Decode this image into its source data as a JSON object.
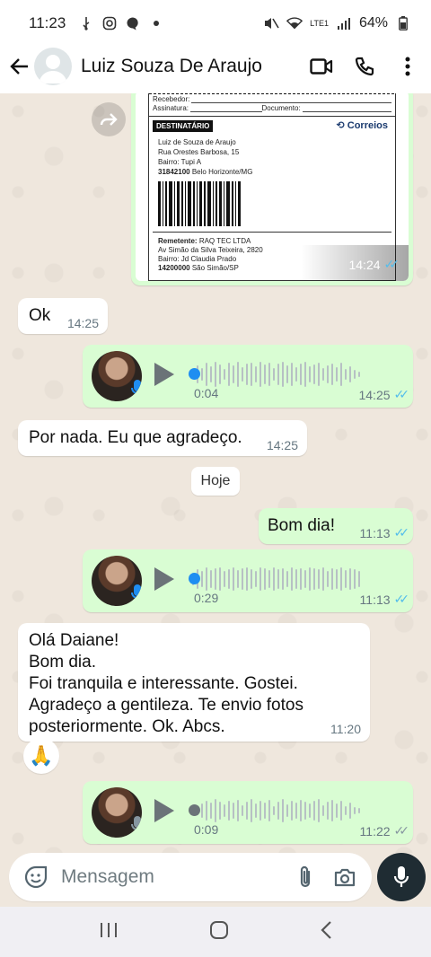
{
  "status": {
    "time": "11:23",
    "battery": "64%",
    "network": "LTE1"
  },
  "header": {
    "contact_name": "Luiz Souza De Araujo"
  },
  "label_image": {
    "recebedor": "Recebedor:",
    "assinatura": "Assinatura:",
    "documento": "Documento:",
    "destinatario": "DESTINATÁRIO",
    "carrier": "Correios",
    "dest_name": "Luiz de Souza de Araujo",
    "dest_street": "Rua Orestes Barbosa, 15",
    "dest_bairro": "Bairro: Tupi A",
    "dest_cep": "31842100",
    "dest_city": "Belo Horizonte/MG",
    "remetente_label": "Remetente:",
    "remetente": "RAQ TEC LTDA",
    "rem_street": "Av Simão da Silva Teixeira, 2820",
    "rem_bairro": "Bairro: Jd Claudia Prado",
    "rem_cep": "14200000",
    "rem_city": "São Simão/SP",
    "time": "14:24"
  },
  "messages": {
    "m1": {
      "text": "Ok",
      "time": "14:25"
    },
    "a1": {
      "duration": "0:04",
      "time": "14:25"
    },
    "m2": {
      "text": "Por nada. Eu que agradeço.",
      "time": "14:25"
    },
    "day": "Hoje",
    "m3": {
      "text": "Bom dia!",
      "time": "11:13"
    },
    "a2": {
      "duration": "0:29",
      "time": "11:13"
    },
    "m4": {
      "lines": [
        "Olá Daiane!",
        "Bom dia.",
        "Foi tranquila e interessante.  Gostei.",
        "Agradeço a gentileza. Te envio fotos",
        "posteriormente. Ok. Abcs."
      ],
      "time": "11:20"
    },
    "reaction": "🙏",
    "a3": {
      "duration": "0:09",
      "time": "11:22"
    }
  },
  "input": {
    "placeholder": "Mensagem"
  },
  "colors": {
    "outgoing": "#d9fdd3",
    "incoming": "#ffffff",
    "read_ticks": "#53bdeb"
  }
}
